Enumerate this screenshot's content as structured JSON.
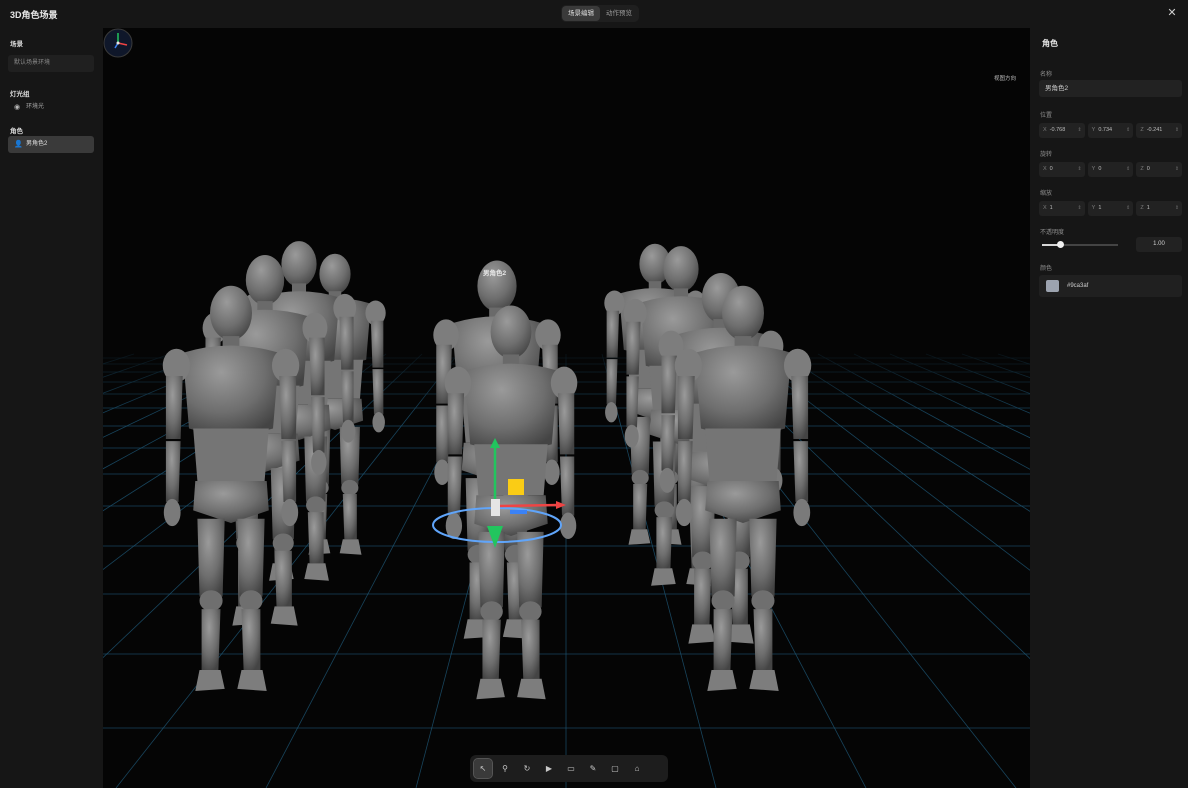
{
  "app": {
    "title": "3D角色场景"
  },
  "top_tabs": [
    {
      "label": "场景编辑",
      "active": true
    },
    {
      "label": "动作预览",
      "active": false
    }
  ],
  "left_panel": {
    "scene_heading": "场景",
    "scene_value": "默认场景环境",
    "lights_heading": "灯光组",
    "light_item": "环境光",
    "characters_heading": "角色",
    "character_item": "男角色2"
  },
  "viewport": {
    "compass_label": "视图方向",
    "selected_label": "男角色2"
  },
  "toolbar": {
    "tools": [
      {
        "icon": "cursor-icon",
        "glyph": "↖",
        "active": true
      },
      {
        "icon": "pose-icon",
        "glyph": "⚲",
        "active": false
      },
      {
        "icon": "rotate-icon",
        "glyph": "↻",
        "active": false
      },
      {
        "icon": "camera-icon",
        "glyph": "▶",
        "active": false
      },
      {
        "icon": "folder-icon",
        "glyph": "▭",
        "active": false
      },
      {
        "icon": "brush-icon",
        "glyph": "✎",
        "active": false
      },
      {
        "icon": "frame-icon",
        "glyph": "▢",
        "active": false
      },
      {
        "icon": "light-icon",
        "glyph": "⌂",
        "active": false
      }
    ]
  },
  "inspector": {
    "title": "角色",
    "name_label": "名称",
    "name_value": "男角色2",
    "position_label": "位置",
    "position": {
      "x": "-0.768",
      "y": "0.734",
      "z": "-0.241"
    },
    "rotation_label": "旋转",
    "rotation": {
      "x": "0",
      "y": "0",
      "z": "0"
    },
    "scale_label": "缩放",
    "scale": {
      "x": "1",
      "y": "1",
      "z": "1"
    },
    "opacity_label": "不透明度",
    "opacity_value": "1.00",
    "opacity_fraction": 0.24,
    "color_label": "颜色",
    "color_hex": "#9ca3af"
  },
  "colors": {
    "grid": "#1f5a7a",
    "gizmo_y": "#22c55e",
    "gizmo_x": "#ef4444",
    "gizmo_z": "#3b82f6",
    "gizmo_ring": "#60a5fa",
    "handle": "#facc15"
  }
}
